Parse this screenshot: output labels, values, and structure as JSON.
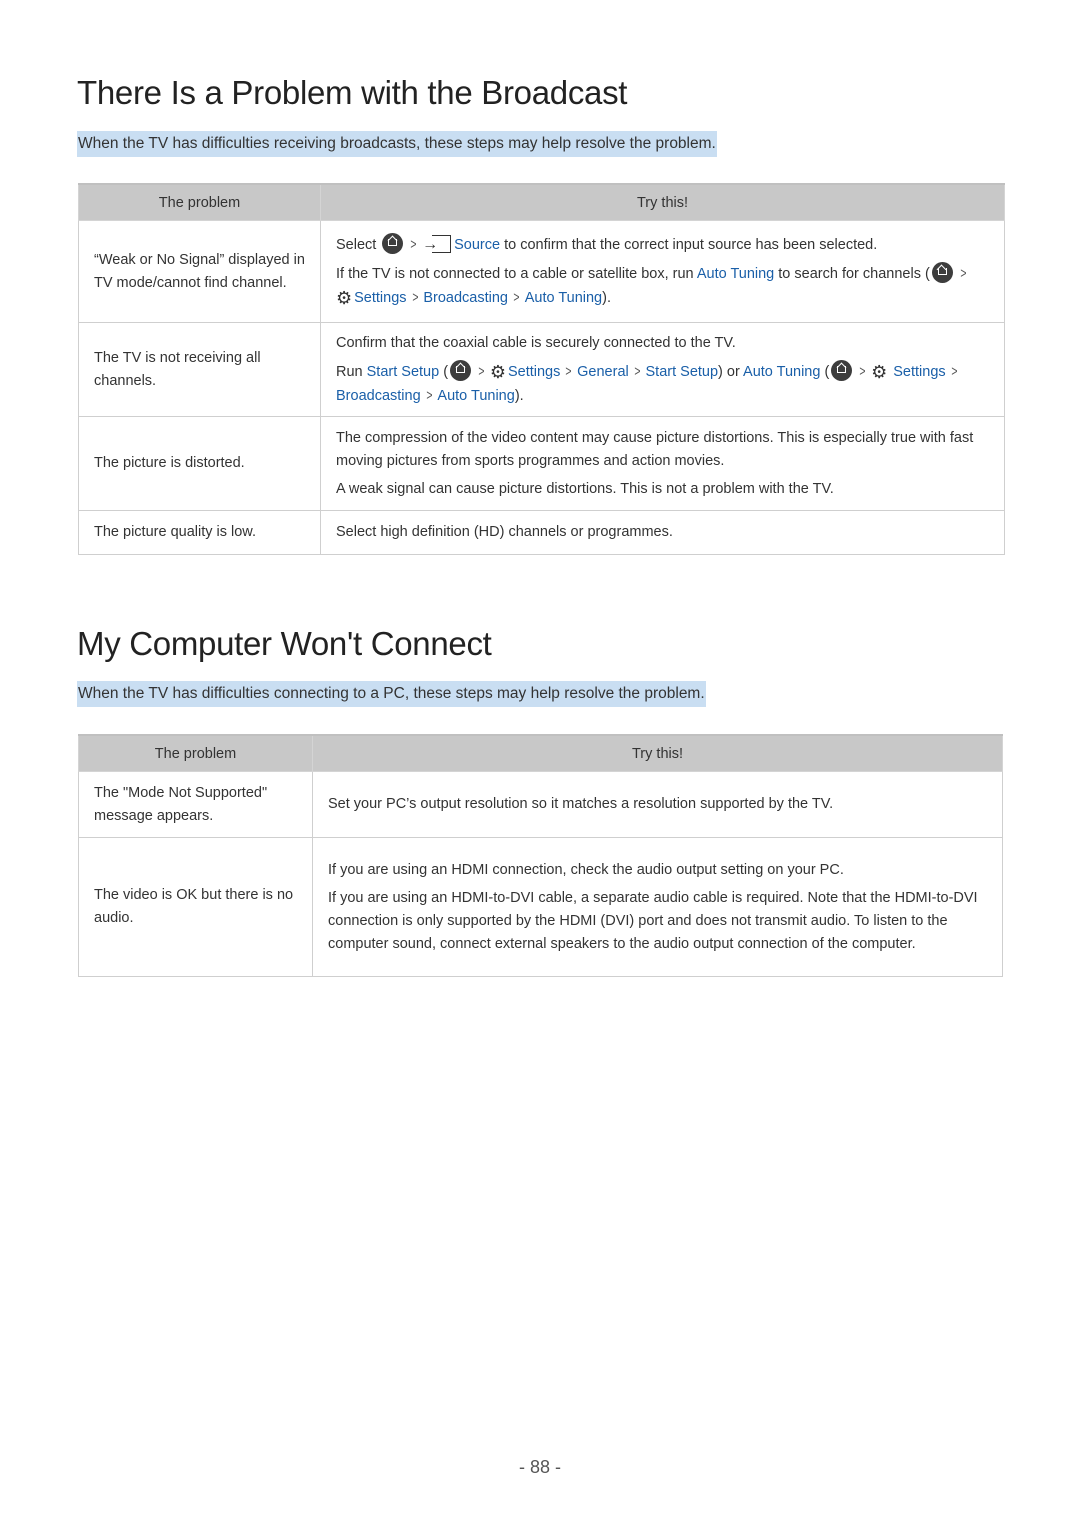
{
  "section1": {
    "title": "There Is a Problem with the Broadcast",
    "intro": "When the TV has difficulties receiving broadcasts, these steps may help resolve the problem.",
    "headers": {
      "problem": "The problem",
      "try": "Try this!"
    },
    "rows": [
      {
        "problem": "“Weak or No Signal” displayed in TV mode/cannot find channel.",
        "try": [
          {
            "pre": "Select",
            "source": "Source",
            "post": "to confirm that the correct input source has been selected."
          },
          {
            "pre": "If the TV is not connected to a cable or satellite box, run",
            "link1": "Auto Tuning",
            "mid": "to search for channels (",
            "settings": "Settings",
            "broadcasting": "Broadcasting",
            "auto": "Auto Tuning",
            "end": ")."
          }
        ]
      },
      {
        "problem": "The TV is not receiving all channels.",
        "try": [
          {
            "text": "Confirm that the coaxial cable is securely connected to the TV."
          },
          {
            "run": "Run",
            "start_setup": "Start Setup",
            "paren": "(",
            "settings": "Settings",
            "general": "General",
            "start_setup2": "Start Setup",
            "or": ") or",
            "auto": "Auto Tuning",
            "paren2": "(",
            "settings2": "Settings",
            "broadcasting": "Broadcasting",
            "auto2": "Auto Tuning",
            "end": ")."
          }
        ]
      },
      {
        "problem": "The picture is distorted.",
        "try": [
          "The compression of the video content may cause picture distortions. This is especially true with fast moving pictures from sports programmes and action movies.",
          "A weak signal can cause picture distortions. This is not a problem with the TV."
        ]
      },
      {
        "problem": "The picture quality is low.",
        "try": [
          "Select high definition (HD) channels or programmes."
        ]
      }
    ]
  },
  "section2": {
    "title": "My Computer Won't Connect",
    "intro": "When the TV has difficulties connecting to a PC, these steps may help resolve the problem.",
    "headers": {
      "problem": "The problem",
      "try": "Try this!"
    },
    "rows": [
      {
        "problem": "The \"Mode Not Supported\" message appears.",
        "try": [
          "Set your PC’s output resolution so it matches a resolution supported by the TV."
        ]
      },
      {
        "problem": "The video is OK but there is no audio.",
        "try": [
          "If you are using an HDMI connection, check the audio output setting on your PC.",
          "If you are using an HDMI-to-DVI cable, a separate audio cable is required. Note that the HDMI-to-DVI connection is only supported by the HDMI (DVI) port and does not transmit audio. To listen to the computer sound, connect external speakers to the audio output connection of the computer."
        ]
      }
    ]
  },
  "page_number": "- 88 -",
  "colors": {
    "link": "#1a5fa8",
    "highlight": "#c9def2",
    "header_bg": "#c8c8c8"
  }
}
